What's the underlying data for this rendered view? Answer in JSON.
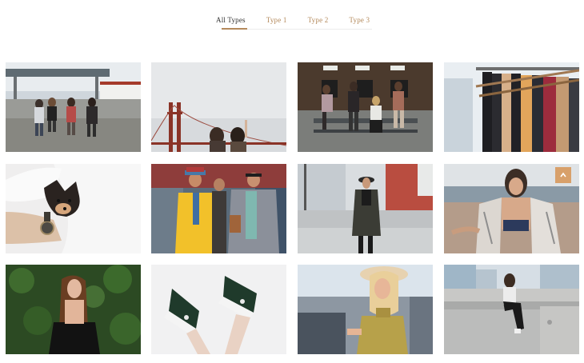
{
  "filter_tabs": [
    {
      "label": "All Types",
      "active": true
    },
    {
      "label": "Type 1",
      "active": false
    },
    {
      "label": "Type 2",
      "active": false
    },
    {
      "label": "Type 3",
      "active": false
    }
  ],
  "colors": {
    "accent": "#b48a5c",
    "active_tab": "#333333",
    "scroll_top_button": "#d8a06a"
  },
  "gallery": {
    "items": [
      {
        "subject": "group-walking-gas-station"
      },
      {
        "subject": "women-golden-gate-bridge"
      },
      {
        "subject": "group-on-bench"
      },
      {
        "subject": "clothing-rack"
      },
      {
        "subject": "chihuahua-with-watch"
      },
      {
        "subject": "men-street-style"
      },
      {
        "subject": "woman-street-hat"
      },
      {
        "subject": "woman-beach-cardigan"
      },
      {
        "subject": "woman-green-hedge"
      },
      {
        "subject": "green-sneakers"
      },
      {
        "subject": "woman-sun-hat"
      },
      {
        "subject": "woman-sitting-rooftop"
      }
    ]
  },
  "scroll_top": {
    "icon": "chevron-up-icon"
  }
}
